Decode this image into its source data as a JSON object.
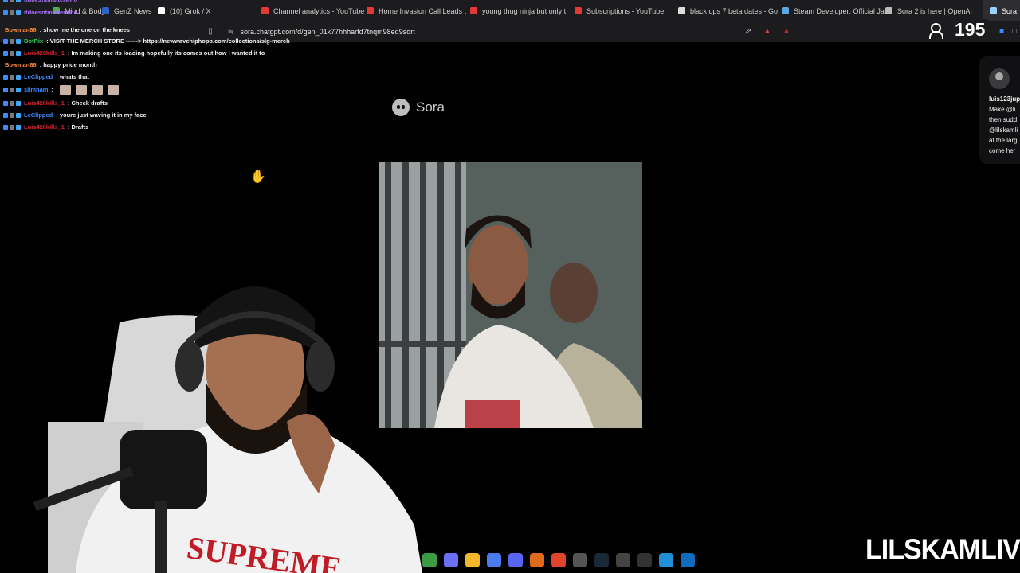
{
  "browser": {
    "tabs": [
      {
        "title": "Mind & Body",
        "color": "#4caf50",
        "active": false
      },
      {
        "title": "GenZ News",
        "color": "#2a63c9",
        "active": false
      },
      {
        "title": "(10) Grok / X",
        "color": "#ffffff",
        "active": false
      },
      {
        "title": "Channel analytics - YouTube",
        "color": "#e53935",
        "active": false
      },
      {
        "title": "Home Invasion Call Leads t",
        "color": "#e53935",
        "active": false
      },
      {
        "title": "young thug ninja but only t",
        "color": "#e53935",
        "active": false
      },
      {
        "title": "Subscriptions - YouTube",
        "color": "#e53935",
        "active": false
      },
      {
        "title": "black ops 7 beta dates - Go",
        "color": "#dddddd",
        "active": false
      },
      {
        "title": "Steam Developer: Official Ja",
        "color": "#5aa9e6",
        "active": false
      },
      {
        "title": "Sora 2 is here | OpenAI",
        "color": "#bbbbbb",
        "active": false
      },
      {
        "title": "Sora",
        "color": "#9ad1ff",
        "active": true
      }
    ],
    "url": "sora.chatgpt.com/d/gen_01k77hhharfd7tnqm98ed9sdrt"
  },
  "chat": {
    "messages": [
      {
        "user": "itdoesntmatterwho",
        "user_color": "#a970ff",
        "text": ""
      },
      {
        "user": "itdoesntmatterwho",
        "user_color": "#a970ff",
        "text": ""
      },
      {
        "user": "Bowman86",
        "user_color": "#ff8c3a",
        "text": ": show me the one on the knees"
      },
      {
        "user": "BotRix",
        "user_color": "#34c759",
        "text": ": VISIT THE MERCH STORE ------> https://newwavehiphopp.com/collections/slg-merch"
      },
      {
        "user": "Luis420kills_1",
        "user_color": "#e0242b",
        "text": ": Im making one its loading hopefully its comes out how I wanted it to"
      },
      {
        "user": "Bowman86",
        "user_color": "#ff8c3a",
        "text": ": happy pride month"
      },
      {
        "user": "LeClipped",
        "user_color": "#3d8bff",
        "text": ": whats that"
      },
      {
        "user": "slimham",
        "user_color": "#3d8bff",
        "text": ":",
        "emotes": 4
      },
      {
        "user": "Luis420kills_1",
        "user_color": "#e0242b",
        "text": ": Check drafts"
      },
      {
        "user": "LeClipped",
        "user_color": "#3d8bff",
        "text": ": youre just waving it in my face"
      },
      {
        "user": "Luis420kills_1",
        "user_color": "#e0242b",
        "text": ": Drafts"
      }
    ]
  },
  "page": {
    "logo_text": "Sora"
  },
  "popup": {
    "lines": [
      "luis123jup",
      "Make @li",
      "then sudd",
      "@lilskamli",
      "at the larg",
      "come her"
    ]
  },
  "stream": {
    "viewer_count": "195",
    "brand_text": "LILSKAMLIVE"
  },
  "taskbar": {
    "icons": [
      {
        "name": "chrome-icon",
        "color": "#3d9b45"
      },
      {
        "name": "copilot-icon",
        "color": "#6b6ff7"
      },
      {
        "name": "file-explorer-icon",
        "color": "#f3b72b"
      },
      {
        "name": "store-icon",
        "color": "#4a7cf0"
      },
      {
        "name": "discord-icon",
        "color": "#5865f2"
      },
      {
        "name": "shield-icon",
        "color": "#e06a1b"
      },
      {
        "name": "brave-icon",
        "color": "#e0442b"
      },
      {
        "name": "obs-icon",
        "color": "#555555"
      },
      {
        "name": "steam-icon",
        "color": "#1b2838"
      },
      {
        "name": "app-icon",
        "color": "#444444"
      },
      {
        "name": "4k-icon",
        "color": "#333333"
      },
      {
        "name": "edge-icon",
        "color": "#1f8fd6"
      },
      {
        "name": "outlook-icon",
        "color": "#0f6cbd"
      }
    ]
  }
}
